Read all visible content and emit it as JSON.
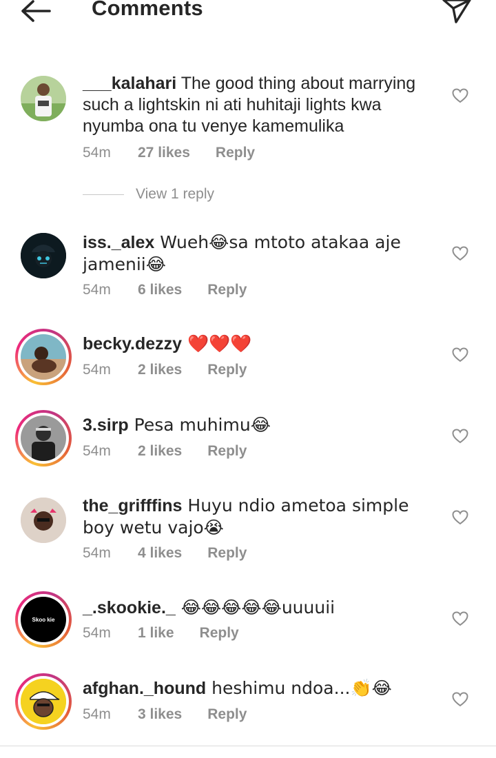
{
  "header": {
    "title": "Comments",
    "back_icon": "arrow-left-icon",
    "send_icon": "paper-plane-icon"
  },
  "comments": [
    {
      "username": "___kalahari",
      "text": " The good thing about marrying such a lightskin ni ati huhitaji lights kwa nyumba ona tu venye kamemulika",
      "time": "54m",
      "likes": "27 likes",
      "reply": "Reply",
      "view_replies": "View 1 reply"
    },
    {
      "username": "iss._alex",
      "text": " Wueh😂sa mtoto atakaa aje jamenii😂",
      "time": "54m",
      "likes": "6 likes",
      "reply": "Reply"
    },
    {
      "username": "becky.dezzy",
      "text": " ❤️❤️❤️",
      "time": "54m",
      "likes": "2 likes",
      "reply": "Reply"
    },
    {
      "username": "3.sirp",
      "text": " Pesa muhimu😂",
      "time": "54m",
      "likes": "2 likes",
      "reply": "Reply"
    },
    {
      "username": "the_grifffins",
      "text": " Huyu ndio ametoa simple boy wetu vajo😭",
      "time": "54m",
      "likes": "4 likes",
      "reply": "Reply"
    },
    {
      "username": "_.skookie._",
      "text": " 😂😂😂😂😂uuuuii",
      "time": "54m",
      "likes": "1 like",
      "reply": "Reply",
      "avatar_text": "Skoo kie"
    },
    {
      "username": "afghan._hound",
      "text": " heshimu ndoa...👏😂",
      "time": "54m",
      "likes": "3 likes",
      "reply": "Reply"
    }
  ],
  "colors": {
    "text": "#262626",
    "meta": "#8e8e8e",
    "story_ring": [
      "#f9c034",
      "#ee2a7b",
      "#c13584"
    ]
  }
}
